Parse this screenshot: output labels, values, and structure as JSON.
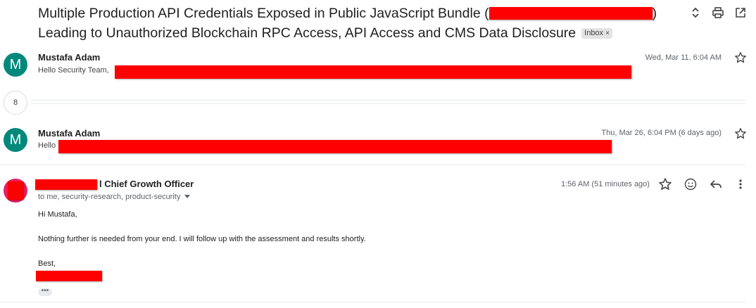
{
  "thread": {
    "subject_part1": "Multiple Production API Credentials Exposed in Public JavaScript Bundle (",
    "subject_part2": ")",
    "subject_line2": "Leading to Unauthorized Blockchain RPC Access, API Access and CMS Data Disclosure",
    "label_chip": "Inbox",
    "label_chip_remove": "×"
  },
  "messages": [
    {
      "avatar_letter": "M",
      "sender": "Mustafa Adam",
      "snippet": "Hello Security Team,",
      "date": "Wed, Mar 11, 6:04 AM"
    },
    {
      "avatar_letter": "M",
      "sender": "Mustafa Adam",
      "snippet": "Hello",
      "date": "Thu, Mar 26, 6:04 PM (6 days ago)"
    }
  ],
  "collapsed_count": "8",
  "expanded": {
    "sender_suffix": "l Chief Growth Officer",
    "recipients": "to me, security-research, product-security",
    "date": "1:56 AM (51 minutes ago)",
    "greeting": "Hi Mustafa,",
    "body": "Nothing further is needed from your end. I will follow up with the assessment and results shortly.",
    "signoff": "Best,",
    "trimmed_indicator": "•••"
  },
  "colors": {
    "avatar": "#00897b",
    "redaction": "#ff0000",
    "avatar_redacted": "#e91e63"
  },
  "icons": [
    "expand-collapse-icon",
    "print-icon",
    "open-in-new-window-icon",
    "star-icon",
    "emoji-icon",
    "reply-icon",
    "more-vert-icon",
    "dropdown-arrow-icon"
  ]
}
